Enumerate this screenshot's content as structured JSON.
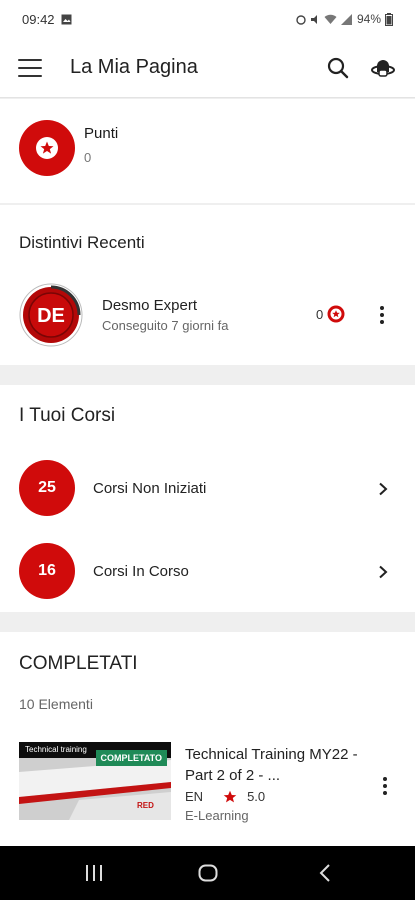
{
  "status_bar": {
    "time": "09:42",
    "battery": "94%",
    "icons": [
      "gallery-icon",
      "alarm-icon",
      "mute-icon",
      "wifi-icon",
      "signal-icon"
    ]
  },
  "app_bar": {
    "title": "La Mia Pagina",
    "icons": [
      "menu-icon",
      "search-icon",
      "avatar-icon"
    ]
  },
  "points": {
    "label": "Punti",
    "value": "0"
  },
  "recent_badges": {
    "title": "Distintivi Recenti",
    "items": [
      {
        "initials": "DE",
        "name": "Desmo Expert",
        "date": "Conseguito 7 giorni fa",
        "points": "0"
      }
    ]
  },
  "courses": {
    "title": "I Tuoi Corsi",
    "rows": [
      {
        "count": "25",
        "label": "Corsi Non Iniziati"
      },
      {
        "count": "16",
        "label": "Corsi In Corso"
      }
    ]
  },
  "completed": {
    "title": "COMPLETATI",
    "count": "10 Elementi",
    "items": [
      {
        "thumb_label": "Technical training",
        "status_tag": "COMPLETATO",
        "title": "Technical Training MY22 - Part 2 of 2 - ...",
        "lang": "EN",
        "rating": "5.0",
        "type": "E-Learning"
      }
    ]
  },
  "colors": {
    "accent": "#d00b0b",
    "completed_tag": "#1f8a57",
    "background": "#efefef"
  }
}
